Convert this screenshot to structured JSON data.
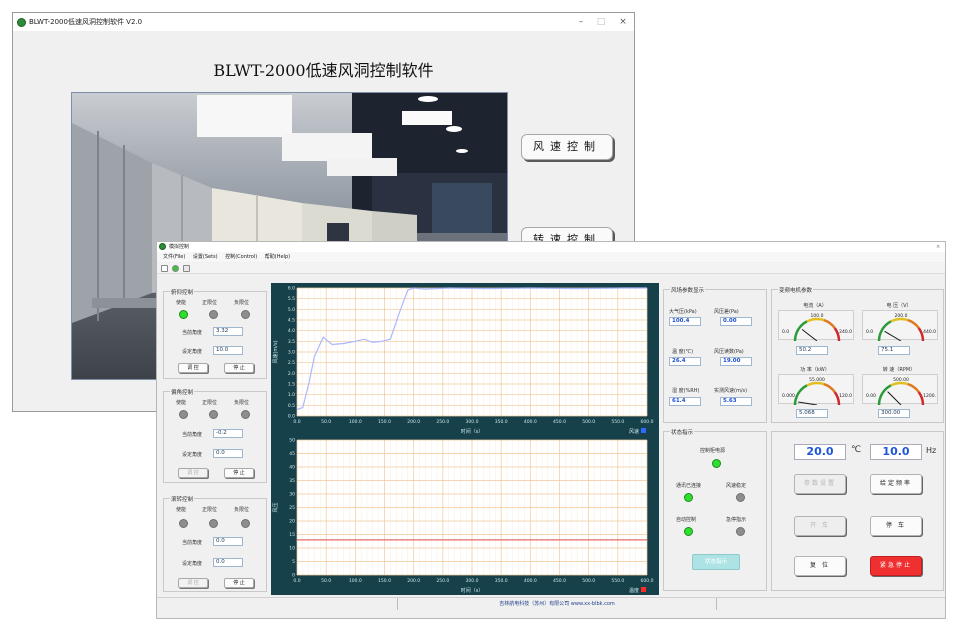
{
  "back_window": {
    "title": "BLWT-2000低速风洞控制软件 V2.0",
    "heading": "BLWT-2000低速风洞控制软件",
    "buttons": {
      "wind_speed": "风速控制",
      "rotation_speed": "转速控制"
    },
    "controls": {
      "minimize": "–",
      "maximize": "□",
      "close": "×"
    }
  },
  "front_window": {
    "title": "模拟控制",
    "menu": [
      "文件(File)",
      "设置(Sets)",
      "控制(Control)",
      "帮助(Help)"
    ],
    "pitch": {
      "title": "俯仰控制",
      "leds": [
        {
          "label": "使能",
          "state": "on"
        },
        {
          "label": "正限位",
          "state": "off"
        },
        {
          "label": "负限位",
          "state": "off"
        }
      ],
      "current_label": "当前角度",
      "current_value": "3.32",
      "set_label": "设定角度",
      "set_value": "10.0",
      "run_label": "调 控",
      "stop_label": "停 止"
    },
    "yaw": {
      "title": "偏角控制",
      "leds": [
        {
          "label": "使能",
          "state": "off"
        },
        {
          "label": "正限位",
          "state": "off"
        },
        {
          "label": "负限位",
          "state": "off"
        }
      ],
      "current_label": "当前角度",
      "current_value": "-0.2",
      "set_label": "设定角度",
      "set_value": "0.0",
      "run_label": "调 控",
      "stop_label": "停 止"
    },
    "roll": {
      "title": "滚转控制",
      "leds": [
        {
          "label": "使能",
          "state": "off"
        },
        {
          "label": "正限位",
          "state": "off"
        },
        {
          "label": "负限位",
          "state": "off"
        }
      ],
      "current_label": "当前角度",
      "current_value": "0.0",
      "set_label": "设定角度",
      "set_value": "0.0",
      "run_label": "调 控",
      "stop_label": "停 止"
    },
    "wind_params": {
      "title": "风场参数显示",
      "fields": [
        {
          "label": "大气压(kPa)",
          "value": "100.4"
        },
        {
          "label": "风压差(Pa)",
          "value": "0.00"
        },
        {
          "label": "温 度(℃)",
          "value": "26.4"
        },
        {
          "label": "风压读数(Pa)",
          "value": "19.00"
        },
        {
          "label": "湿 度(%RH)",
          "value": "61.4"
        },
        {
          "label": "实测风速(m/s)",
          "value": "5.63"
        }
      ]
    },
    "vfd_params": {
      "title": "变频电机参数",
      "gauges": [
        {
          "title": "电流（A）",
          "value": "50.2",
          "min": "0.0",
          "max": "240.0",
          "mid": "100.0",
          "reading": 0.21
        },
        {
          "title": "电 压（V）",
          "value": "75.1",
          "min": "0.0",
          "max": "440.0",
          "mid": "200.0",
          "reading": 0.17
        },
        {
          "title": "功 率（kW）",
          "value": "5.068",
          "min": "0.000",
          "max": "120.0",
          "mid": "55.000",
          "reading": 0.05
        },
        {
          "title": "转 速（RPM）",
          "value": "300.00",
          "min": "0.00",
          "max": "1200.",
          "mid": "500.00",
          "reading": 0.25
        }
      ]
    },
    "status": {
      "title": "状态指示",
      "items": [
        {
          "label": "控制柜电源",
          "state": "on"
        },
        {
          "label": "通讯已连接",
          "state": "on"
        },
        {
          "label": "风速稳定",
          "state": "off"
        },
        {
          "label": "自动控制",
          "state": "on"
        },
        {
          "label": "急停指示",
          "state": "off"
        }
      ],
      "button": "状态指示"
    },
    "control": {
      "temp_value": "20.0",
      "temp_unit": "℃",
      "freq_value": "10.0",
      "freq_unit": "Hz",
      "buttons": {
        "params": "参数设置",
        "set_freq": "给定频率",
        "start": "开 车",
        "stop": "停 车",
        "reset": "复 位",
        "estop": "紧急停止"
      }
    },
    "charts": {
      "top_xlabel": "时间（s）",
      "bottom_xlabel": "时间（s）",
      "top_ylabel": "风速(m/s)",
      "bottom_ylabel": "风压",
      "top_legend": "风速",
      "bottom_legend": "温度"
    },
    "statusbar": "吉林航电科技（苏州）有限公司 www.xx-blbk.com"
  },
  "chart_data": [
    {
      "type": "line",
      "title": "",
      "xlabel": "时间（s）",
      "ylabel": "风速(m/s)",
      "x_ticks": [
        "0.0",
        "50.0",
        "100.0",
        "150.0",
        "200.0",
        "250.0",
        "300.0",
        "350.0",
        "400.0",
        "450.0",
        "500.0",
        "550.0",
        "600.0"
      ],
      "y_ticks": [
        "0.0",
        "0.5",
        "1.0",
        "1.5",
        "2.0",
        "2.5",
        "3.0",
        "3.5",
        "4.0",
        "4.5",
        "5.0",
        "5.5",
        "6.0"
      ],
      "xlim": [
        0,
        600
      ],
      "ylim": [
        0,
        6
      ],
      "series": [
        {
          "name": "风速",
          "color": "#aab8ff",
          "x": [
            0,
            10,
            20,
            30,
            45,
            60,
            80,
            100,
            115,
            130,
            145,
            160,
            175,
            190,
            200,
            220,
            260,
            320,
            400,
            480,
            560,
            600
          ],
          "y": [
            0.3,
            0.4,
            1.5,
            2.8,
            3.7,
            3.35,
            3.4,
            3.5,
            3.6,
            3.45,
            3.5,
            3.6,
            4.8,
            5.9,
            6.0,
            5.95,
            6.0,
            5.97,
            6.0,
            5.97,
            6.0,
            6.0
          ]
        }
      ]
    },
    {
      "type": "line",
      "title": "",
      "xlabel": "时间（s）",
      "ylabel": "风压",
      "x_ticks": [
        "0.0",
        "50.0",
        "100.0",
        "150.0",
        "200.0",
        "250.0",
        "300.0",
        "350.0",
        "400.0",
        "450.0",
        "500.0",
        "550.0",
        "600.0"
      ],
      "y_ticks": [
        "0",
        "5",
        "10",
        "15",
        "20",
        "25",
        "30",
        "35",
        "40",
        "45",
        "50"
      ],
      "xlim": [
        0,
        600
      ],
      "ylim": [
        0,
        50
      ],
      "series": [
        {
          "name": "温度",
          "color": "#e56a6a",
          "x": [
            0,
            600
          ],
          "y": [
            13,
            13
          ]
        }
      ]
    }
  ]
}
